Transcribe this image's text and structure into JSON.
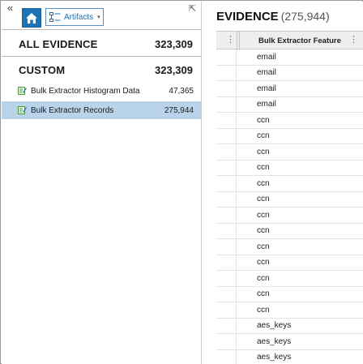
{
  "toolbar": {
    "collapse_glyph": "«",
    "home_icon": "home-icon",
    "artifacts_label": "Artifacts",
    "caret_glyph": "▾",
    "pin_glyph": "⇱"
  },
  "left_panel": {
    "all_evidence": {
      "label": "ALL EVIDENCE",
      "count": "323,309"
    },
    "custom": {
      "label": "CUSTOM",
      "count": "323,309"
    },
    "items": [
      {
        "label": "Bulk Extractor Histogram Data",
        "count": "47,365",
        "icon": "edit-note-icon"
      },
      {
        "label": "Bulk Extractor Records",
        "count": "275,944",
        "icon": "edit-note-icon"
      }
    ]
  },
  "right_panel": {
    "title": "EVIDENCE",
    "count": "(275,944)",
    "column_header": "Bulk Extractor Feature",
    "column_menu_glyph": "⋮",
    "rows": [
      "email",
      "email",
      "email",
      "email",
      "ccn",
      "ccn",
      "ccn",
      "ccn",
      "ccn",
      "ccn",
      "ccn",
      "ccn",
      "ccn",
      "ccn",
      "ccn",
      "ccn",
      "ccn",
      "aes_keys",
      "aes_keys",
      "aes_keys"
    ]
  },
  "colors": {
    "accent": "#1e73b4",
    "selected_row": "#b9d4ea",
    "icon_green": "#4a9a3a"
  }
}
